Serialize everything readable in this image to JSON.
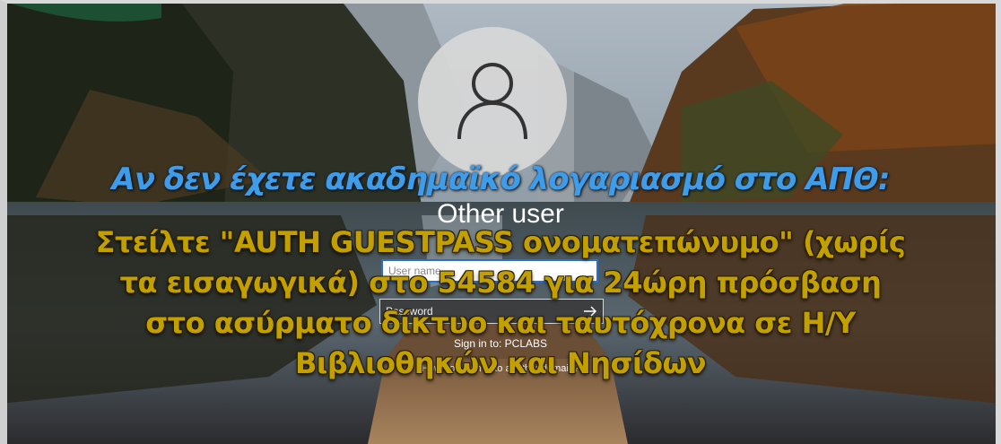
{
  "lock_screen": {
    "account_name": "Other user",
    "username_placeholder": "User name",
    "password_placeholder": "Password",
    "sign_in_to": "Sign in to: PCLABS",
    "other_domain_link": "How do I sign in to another domain?"
  },
  "overlay": {
    "title": "Αν δεν έχετε ακαδημαϊκό λογαριασμό στο ΑΠΘ:",
    "lines": [
      "Στείλτε \"AUTH GUESTPASS ονοματεπώνυμο\" (χωρίς",
      "τα εισαγωγικά) στο 54584 για 24ώρη πρόσβαση",
      "στο ασύρματο δίκτυο και ταυτόχρονα σε Η/Υ",
      "Βιβλιοθηκών και Νησίδων"
    ]
  },
  "icons": {
    "avatar": "user-silhouette-icon",
    "submit": "arrow-right-icon"
  },
  "colors": {
    "title_blue": "#3e9ce8",
    "body_gold": "#c2a000",
    "field_border_blue": "#2b6fc9"
  }
}
